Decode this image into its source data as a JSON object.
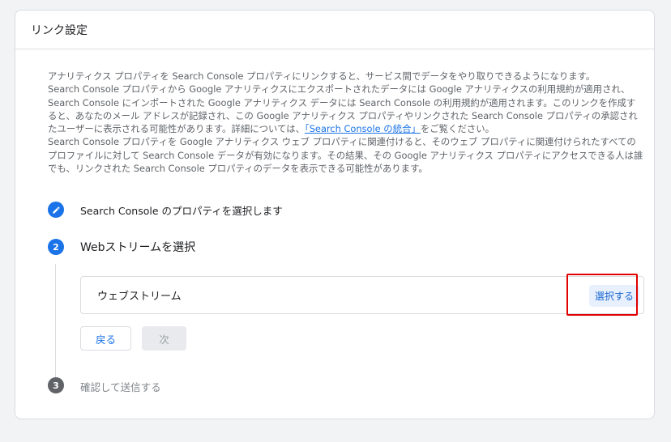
{
  "header": {
    "title": "リンク設定"
  },
  "description": {
    "line1": "アナリティクス プロパティを Search Console プロパティにリンクすると、サービス間でデータをやり取りできるようになります。",
    "para2_before_link": "Search Console プロパティから Google アナリティクスにエクスポートされたデータには Google アナリティクスの利用規約が適用され、Search Console にインポートされた Google アナリティクス データには Search Console の利用規約が適用されます。このリンクを作成すると、あなたのメール アドレスが記録され、この Google アナリティクス プロパティやリンクされた Search Console プロパティの承認されたユーザーに表示される可能性があります。詳細については、",
    "link_text": "「Search Console の統合」",
    "para2_after_link": "をご覧ください。",
    "para3": "Search Console プロパティを Google アナリティクス ウェブ プロパティに関連付けると、そのウェブ プロパティに関連付けられたすべてのプロファイルに対して Search Console データが有効になります。その結果、その Google アナリティクス プロパティにアクセスできる人は誰でも、リンクされた Search Console プロパティのデータを表示できる可能性があります。"
  },
  "steps": [
    {
      "label": "Search Console のプロパティを選択します",
      "state": "done",
      "icon": "pencil-icon"
    },
    {
      "number": "2",
      "label": "Webストリームを選択",
      "state": "active"
    },
    {
      "number": "3",
      "label": "確認して送信する",
      "state": "pending"
    }
  ],
  "stream": {
    "label": "ウェブストリーム",
    "select_button": "選択する"
  },
  "buttons": {
    "back": "戻る",
    "next": "次"
  },
  "colors": {
    "accent": "#1a73e8",
    "highlight": "#e00000"
  }
}
